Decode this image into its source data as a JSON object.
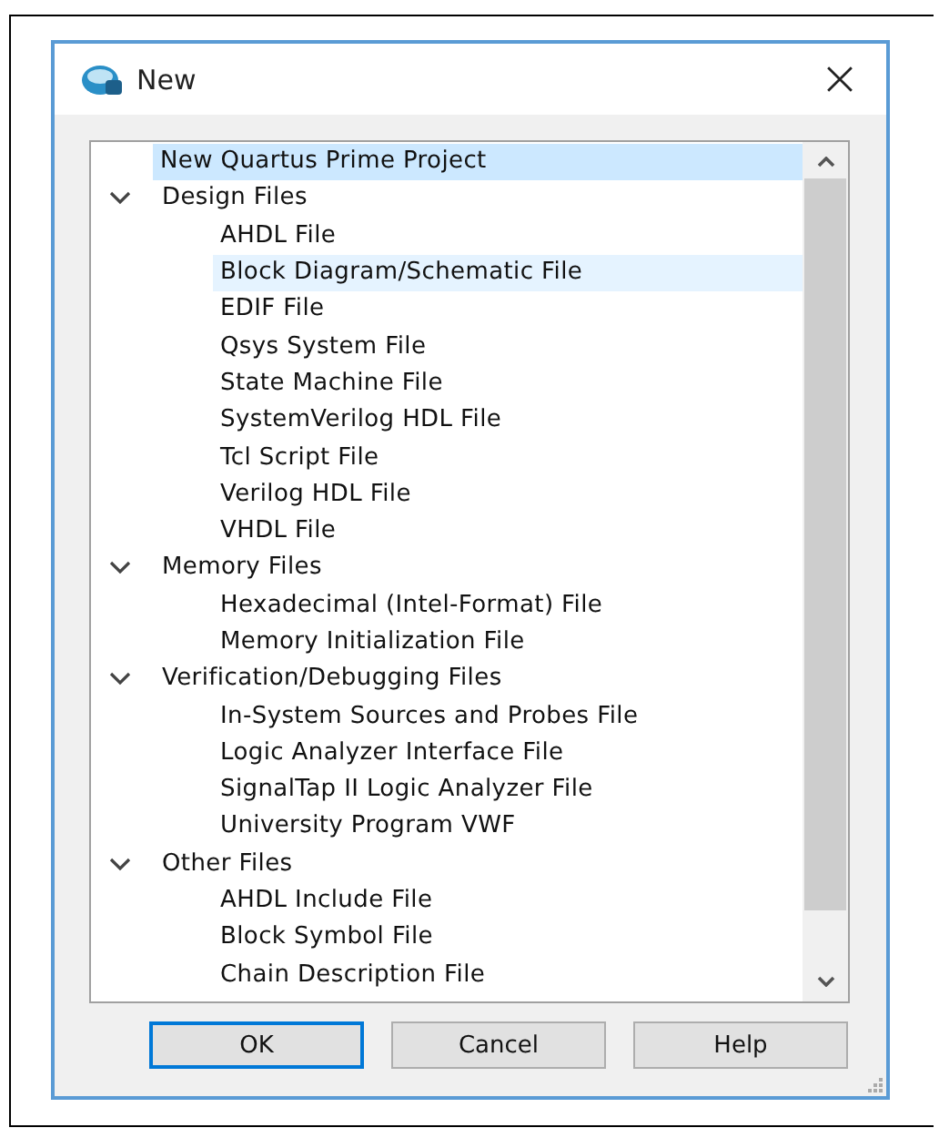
{
  "window": {
    "title": "New"
  },
  "tree": [
    {
      "kind": "file",
      "label": "New Quartus Prime Project",
      "selected": true,
      "hovered": false
    },
    {
      "kind": "group",
      "label": "Design Files",
      "expanded": true,
      "children": [
        {
          "kind": "file",
          "label": "AHDL File",
          "selected": false,
          "hovered": false
        },
        {
          "kind": "file",
          "label": "Block Diagram/Schematic File",
          "selected": false,
          "hovered": true
        },
        {
          "kind": "file",
          "label": "EDIF File",
          "selected": false,
          "hovered": false
        },
        {
          "kind": "file",
          "label": "Qsys System File",
          "selected": false,
          "hovered": false
        },
        {
          "kind": "file",
          "label": "State Machine File",
          "selected": false,
          "hovered": false
        },
        {
          "kind": "file",
          "label": "SystemVerilog HDL File",
          "selected": false,
          "hovered": false
        },
        {
          "kind": "file",
          "label": "Tcl Script File",
          "selected": false,
          "hovered": false
        },
        {
          "kind": "file",
          "label": "Verilog HDL File",
          "selected": false,
          "hovered": false
        },
        {
          "kind": "file",
          "label": "VHDL File",
          "selected": false,
          "hovered": false
        }
      ]
    },
    {
      "kind": "group",
      "label": "Memory Files",
      "expanded": true,
      "children": [
        {
          "kind": "file",
          "label": "Hexadecimal (Intel-Format) File",
          "selected": false,
          "hovered": false
        },
        {
          "kind": "file",
          "label": "Memory Initialization File",
          "selected": false,
          "hovered": false
        }
      ]
    },
    {
      "kind": "group",
      "label": "Verification/Debugging Files",
      "expanded": true,
      "children": [
        {
          "kind": "file",
          "label": "In-System Sources and Probes File",
          "selected": false,
          "hovered": false
        },
        {
          "kind": "file",
          "label": "Logic Analyzer Interface File",
          "selected": false,
          "hovered": false
        },
        {
          "kind": "file",
          "label": "SignalTap II Logic Analyzer File",
          "selected": false,
          "hovered": false
        },
        {
          "kind": "file",
          "label": "University Program VWF",
          "selected": false,
          "hovered": false
        }
      ]
    },
    {
      "kind": "group",
      "label": "Other Files",
      "expanded": true,
      "children": [
        {
          "kind": "file",
          "label": "AHDL Include File",
          "selected": false,
          "hovered": false
        },
        {
          "kind": "file",
          "label": "Block Symbol File",
          "selected": false,
          "hovered": false
        },
        {
          "kind": "file",
          "label": "Chain Description File",
          "selected": false,
          "hovered": false
        }
      ]
    }
  ],
  "buttons": [
    {
      "label": "OK",
      "default": true
    },
    {
      "label": "Cancel",
      "default": false
    },
    {
      "label": "Help",
      "default": false
    }
  ]
}
